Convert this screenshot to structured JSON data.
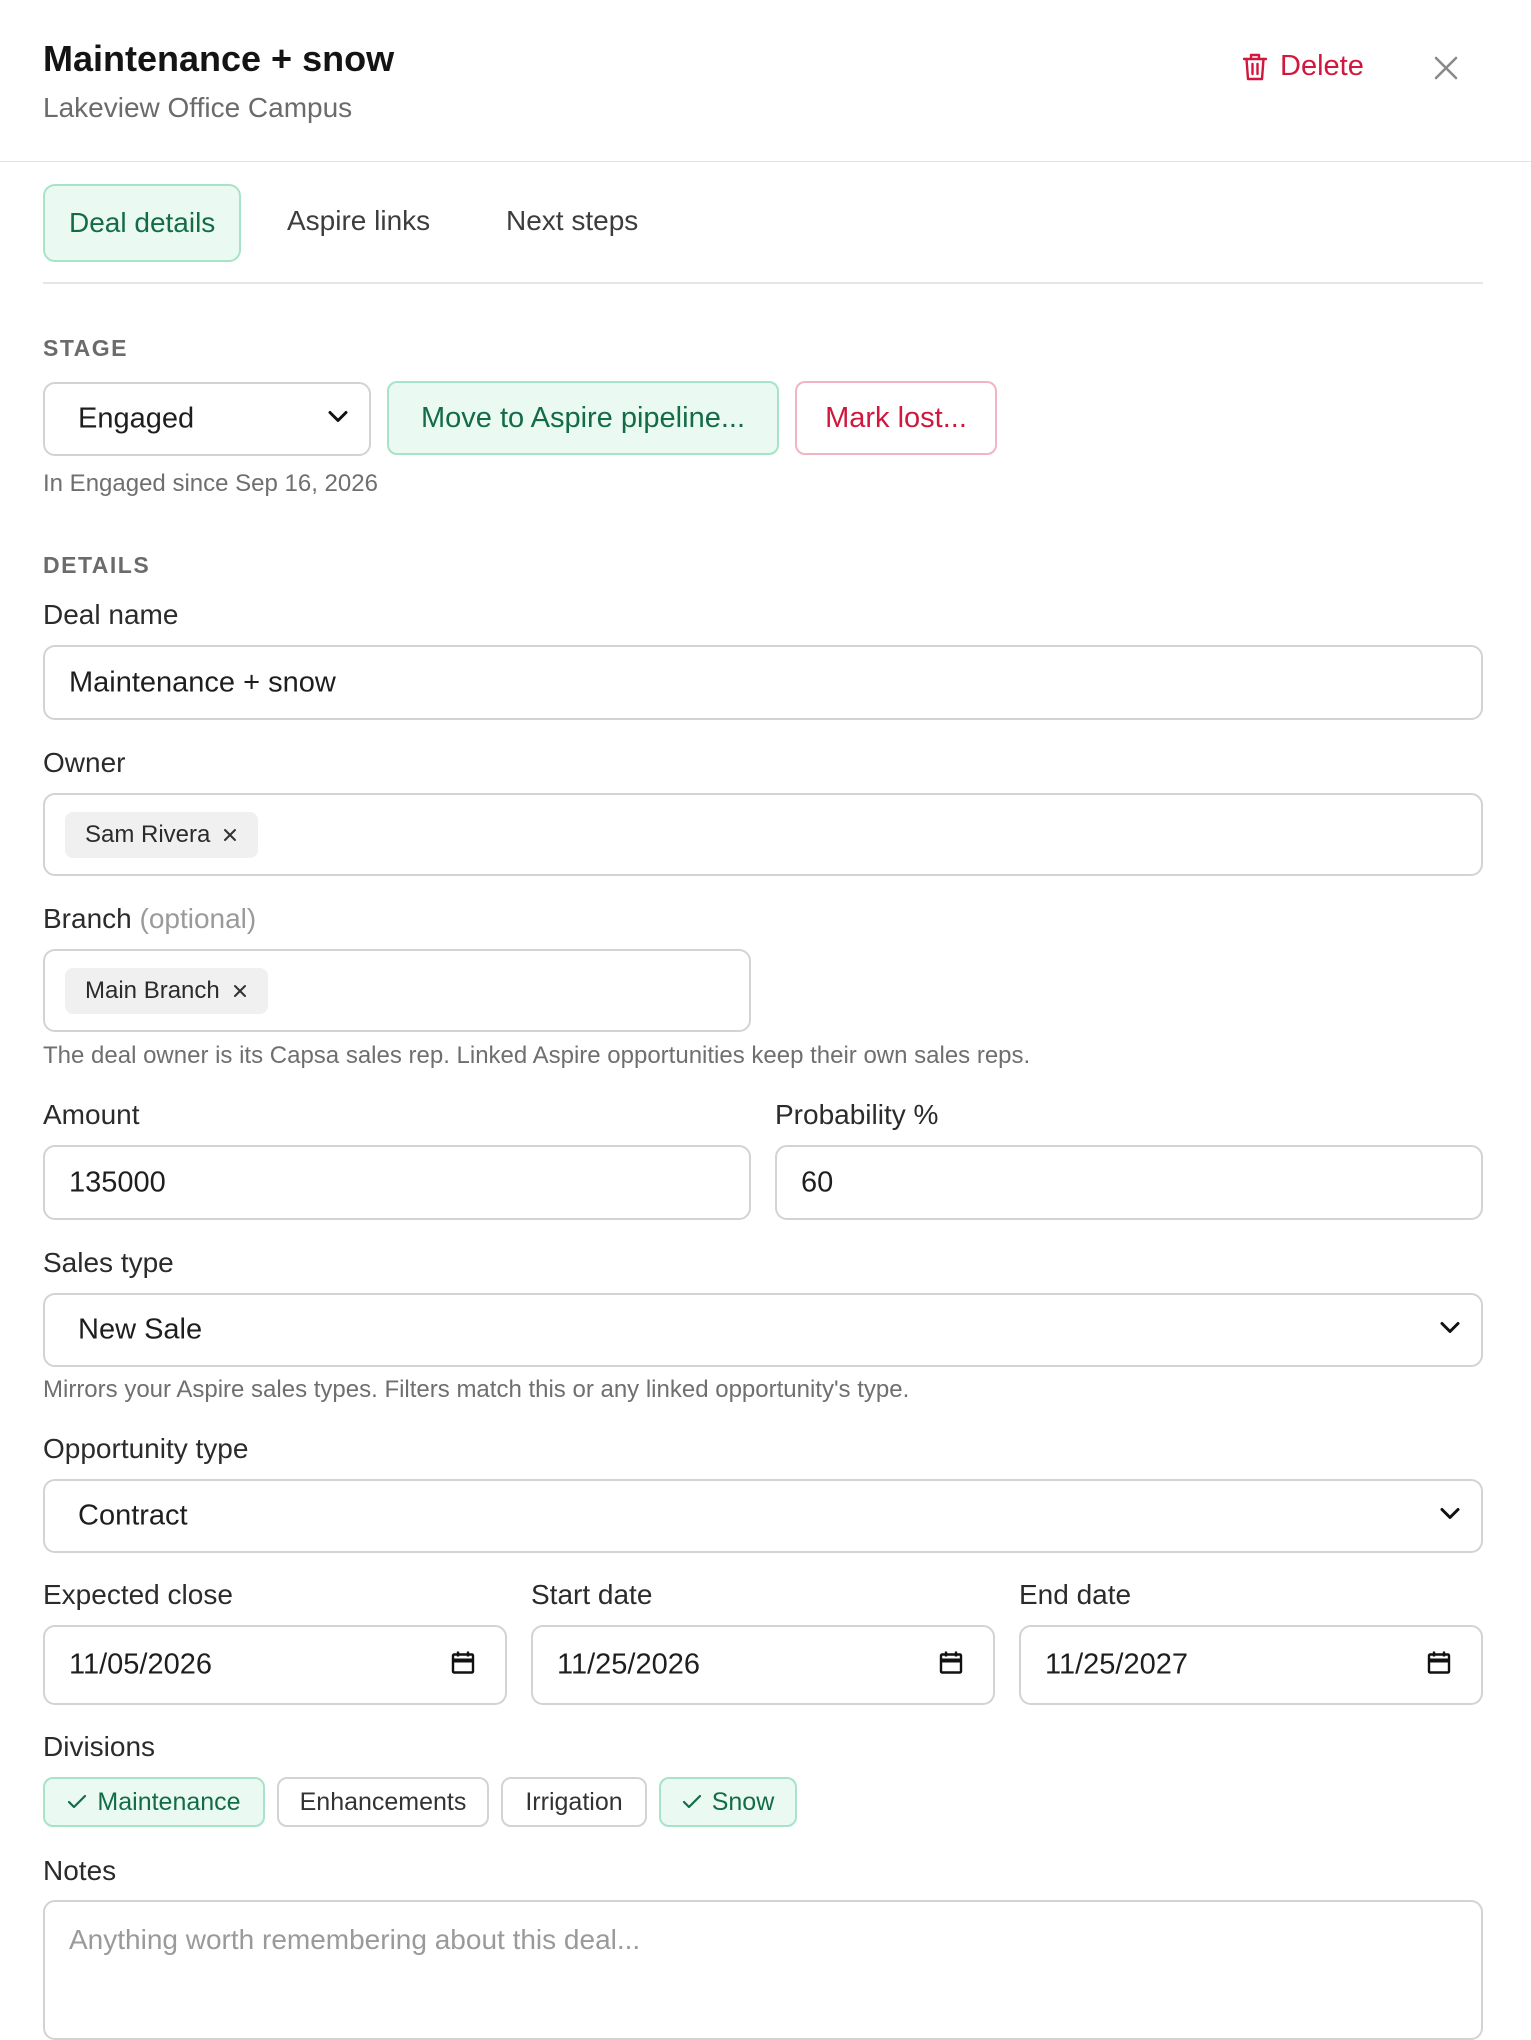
{
  "header": {
    "title": "Maintenance + snow",
    "subtitle": "Lakeview Office Campus",
    "delete_label": "Delete"
  },
  "tabs": [
    {
      "label": "Deal details",
      "active": true
    },
    {
      "label": "Aspire links",
      "active": false
    },
    {
      "label": "Next steps",
      "active": false
    }
  ],
  "stage": {
    "section_label": "STAGE",
    "selected": "Engaged",
    "move_button": "Move to Aspire pipeline...",
    "lost_button": "Mark lost...",
    "since_text": "In Engaged since Sep 16, 2026"
  },
  "details": {
    "section_label": "DETAILS",
    "deal_name_label": "Deal name",
    "deal_name_value": "Maintenance + snow",
    "owner_label": "Owner",
    "owner_chip": "Sam Rivera",
    "branch_label": "Branch",
    "branch_optional": "(optional)",
    "branch_chip": "Main Branch",
    "owner_hint": "The deal owner is its Capsa sales rep. Linked Aspire opportunities keep their own sales reps.",
    "amount_label": "Amount",
    "amount_value": "135000",
    "probability_label": "Probability %",
    "probability_value": "60",
    "sales_type_label": "Sales type",
    "sales_type_value": "New Sale",
    "sales_type_hint": "Mirrors your Aspire sales types. Filters match this or any linked opportunity's type.",
    "opportunity_type_label": "Opportunity type",
    "opportunity_type_value": "Contract",
    "expected_close_label": "Expected close",
    "expected_close_value": "11/05/2026",
    "start_date_label": "Start date",
    "start_date_value": "11/25/2026",
    "end_date_label": "End date",
    "end_date_value": "11/25/2027",
    "divisions_label": "Divisions",
    "divisions": [
      {
        "label": "Maintenance",
        "selected": true
      },
      {
        "label": "Enhancements",
        "selected": false
      },
      {
        "label": "Irrigation",
        "selected": false
      },
      {
        "label": "Snow",
        "selected": true
      }
    ],
    "notes_label": "Notes",
    "notes_placeholder": "Anything worth remembering about this deal..."
  },
  "colors": {
    "accent_green": "#146c47",
    "accent_green_bg": "#eafaf3",
    "danger_red": "#d1173d"
  }
}
